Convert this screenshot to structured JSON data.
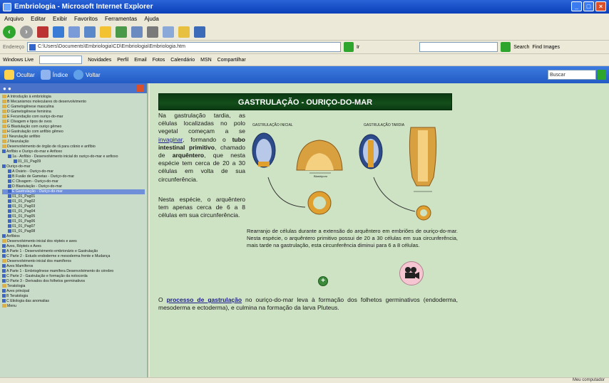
{
  "window": {
    "title": "Embriologia - Microsoft Internet Explorer",
    "min": "_",
    "max": "□",
    "close": "×"
  },
  "menu": [
    "Arquivo",
    "Editar",
    "Exibir",
    "Favoritos",
    "Ferramentas",
    "Ajuda"
  ],
  "address": {
    "label": "Endereço",
    "url": "C:\\Users\\Documents\\Embriologia\\CD\\Embriologia\\Embriologia.htm",
    "go": "Ir",
    "search_label": "Search",
    "image_label": "Find Images"
  },
  "links": [
    "Windows Live",
    "Novidades",
    "Perfil",
    "Email",
    "Fotos",
    "Calendário",
    "MSN",
    "Compartilhar"
  ],
  "chm": {
    "back": "Ocultar",
    "index": "Índice",
    "forward": "Voltar",
    "search_placeholder": "Buscar"
  },
  "tree": [
    {
      "lvl": 1,
      "icon": "book",
      "text": "A Introdução à embriologia"
    },
    {
      "lvl": 1,
      "icon": "book",
      "text": "B Mecanismos moleculares do desenvolvimento"
    },
    {
      "lvl": 1,
      "icon": "book",
      "text": "C Gametogênese masculina"
    },
    {
      "lvl": 1,
      "icon": "book",
      "text": "D Gametogênese feminina"
    },
    {
      "lvl": 1,
      "icon": "book",
      "text": "E Fecundação com ouriço-do-mar"
    },
    {
      "lvl": 1,
      "icon": "book",
      "text": "F Clivagem e tipos de ovos"
    },
    {
      "lvl": 1,
      "icon": "book",
      "text": "G Blastulação com ouriço gêmeo"
    },
    {
      "lvl": 1,
      "icon": "book",
      "text": "H Gastrulação com anfíbio gêmeo"
    },
    {
      "lvl": 1,
      "icon": "book",
      "text": "I Neurulação anfíbio"
    },
    {
      "lvl": 1,
      "icon": "book",
      "text": "J Neurulação"
    },
    {
      "lvl": 1,
      "icon": "book",
      "text": "Desenvolvimento de órgão de rã para crânio e anfíbio"
    },
    {
      "lvl": 1,
      "icon": "open",
      "text": "Anfíbio e Ouriço-do-mar e Anfioxo"
    },
    {
      "lvl": 2,
      "icon": "page",
      "text": "1a - Anfíbio - Desenvolvimento inicial do ouriço-do-mar e anfioxo"
    },
    {
      "lvl": 3,
      "icon": "page",
      "text": "01_01_Pag09"
    },
    {
      "lvl": 1,
      "icon": "open",
      "text": "Ouriço-do-mar"
    },
    {
      "lvl": 2,
      "icon": "page",
      "text": "A Ovário - Ouriço-do-mar"
    },
    {
      "lvl": 2,
      "icon": "page",
      "text": "B Fusão de Gametas - Ouriço-do-mar"
    },
    {
      "lvl": 2,
      "icon": "page",
      "text": "C Clivagem - Ouriço-do-mar"
    },
    {
      "lvl": 2,
      "icon": "page",
      "text": "D Blastulação - Ouriço-do-mar"
    },
    {
      "lvl": 2,
      "icon": "page",
      "text": "E Gastrulação - Ouriço-do-mar",
      "selected": true
    },
    {
      "lvl": 2,
      "icon": "page",
      "text": "01_01_Pag01"
    },
    {
      "lvl": 2,
      "icon": "page",
      "text": "01_01_Pag02"
    },
    {
      "lvl": 2,
      "icon": "page",
      "text": "01_01_Pag03"
    },
    {
      "lvl": 2,
      "icon": "page",
      "text": "01_01_Pag04"
    },
    {
      "lvl": 2,
      "icon": "page",
      "text": "01_01_Pag05"
    },
    {
      "lvl": 2,
      "icon": "page",
      "text": "01_01_Pag06"
    },
    {
      "lvl": 2,
      "icon": "page",
      "text": "01_01_Pag07"
    },
    {
      "lvl": 2,
      "icon": "page",
      "text": "01_01_Pag08"
    },
    {
      "lvl": 1,
      "icon": "open",
      "text": "Anfíbios"
    },
    {
      "lvl": 1,
      "icon": "book",
      "text": "Desenvolvimento inicial dos répteis e aves"
    },
    {
      "lvl": 1,
      "icon": "open",
      "text": "Aves, Répteis e Aves"
    },
    {
      "lvl": 1,
      "icon": "open",
      "text": "A Parte 1 - Desenvolvimento embrionário e Gastrulação"
    },
    {
      "lvl": 1,
      "icon": "open",
      "text": "C Parte 2 - Estudo endoderme e mesoderma frente e Mudança"
    },
    {
      "lvl": 1,
      "icon": "book",
      "text": "Desenvolvimento inicial dos mamíferos"
    },
    {
      "lvl": 1,
      "icon": "open",
      "text": "Aves Mamíferos"
    },
    {
      "lvl": 1,
      "icon": "open",
      "text": "A Parte 1 - Embriogênese mamífera Desenvolvimento do cérebro"
    },
    {
      "lvl": 1,
      "icon": "open",
      "text": "C Parte 2 - Gastrulação e formação da notocorda"
    },
    {
      "lvl": 1,
      "icon": "open",
      "text": "D Parte 3 - Derivados dos folhetos germinativos"
    },
    {
      "lvl": 1,
      "icon": "book",
      "text": "Teratologia"
    },
    {
      "lvl": 1,
      "icon": "open",
      "text": "Aves principal"
    },
    {
      "lvl": 1,
      "icon": "open",
      "text": "B Teratologia"
    },
    {
      "lvl": 1,
      "icon": "open",
      "text": "C Etiologia das anomalias"
    },
    {
      "lvl": 1,
      "icon": "book",
      "text": "Menu"
    }
  ],
  "content": {
    "title": "GASTRULAÇÃO - OURIÇO-DO-MAR",
    "intro_a": "Na gastrulação tardia, as células localizadas no polo vegetal começam a se ",
    "intro_link": "invaginar",
    "intro_b": ", formando o ",
    "intro_bold": "tubo intestinal primitivo",
    "intro_c": ", chamado de ",
    "intro_bold2": "arquêntero",
    "intro_d": ", que nesta espécie tem cerca de 20 a 30 células em volta de sua circunferência.",
    "intro2": "Nesta espécie, o arquêntero tem apenas cerca de 6 a 8 células em sua circunferência.",
    "label_early": "GASTRULAÇÃO INICIAL",
    "label_late": "GASTRULAÇÃO TARDIA",
    "label_blasto": "Blastóporo",
    "caption": "Rearranjo de células durante a extensão do arquêntero em embriões de ouriço-do-mar. Nesta espécie, o arquêntero primitivo possui de 20 a 30 células em sua circunferência, mais tarde na gastrulação, esta circunferência diminui para 6 a 8 células.",
    "bottom_a": "O ",
    "bottom_link": "processo de gastrulação",
    "bottom_b": " no ouriço-do-mar leva à formação dos folhetos germinativos (endoderma, mesoderma e ectoderma), e culmina na formação da larva Pluteus."
  },
  "status": {
    "zone": "Meu computador"
  }
}
